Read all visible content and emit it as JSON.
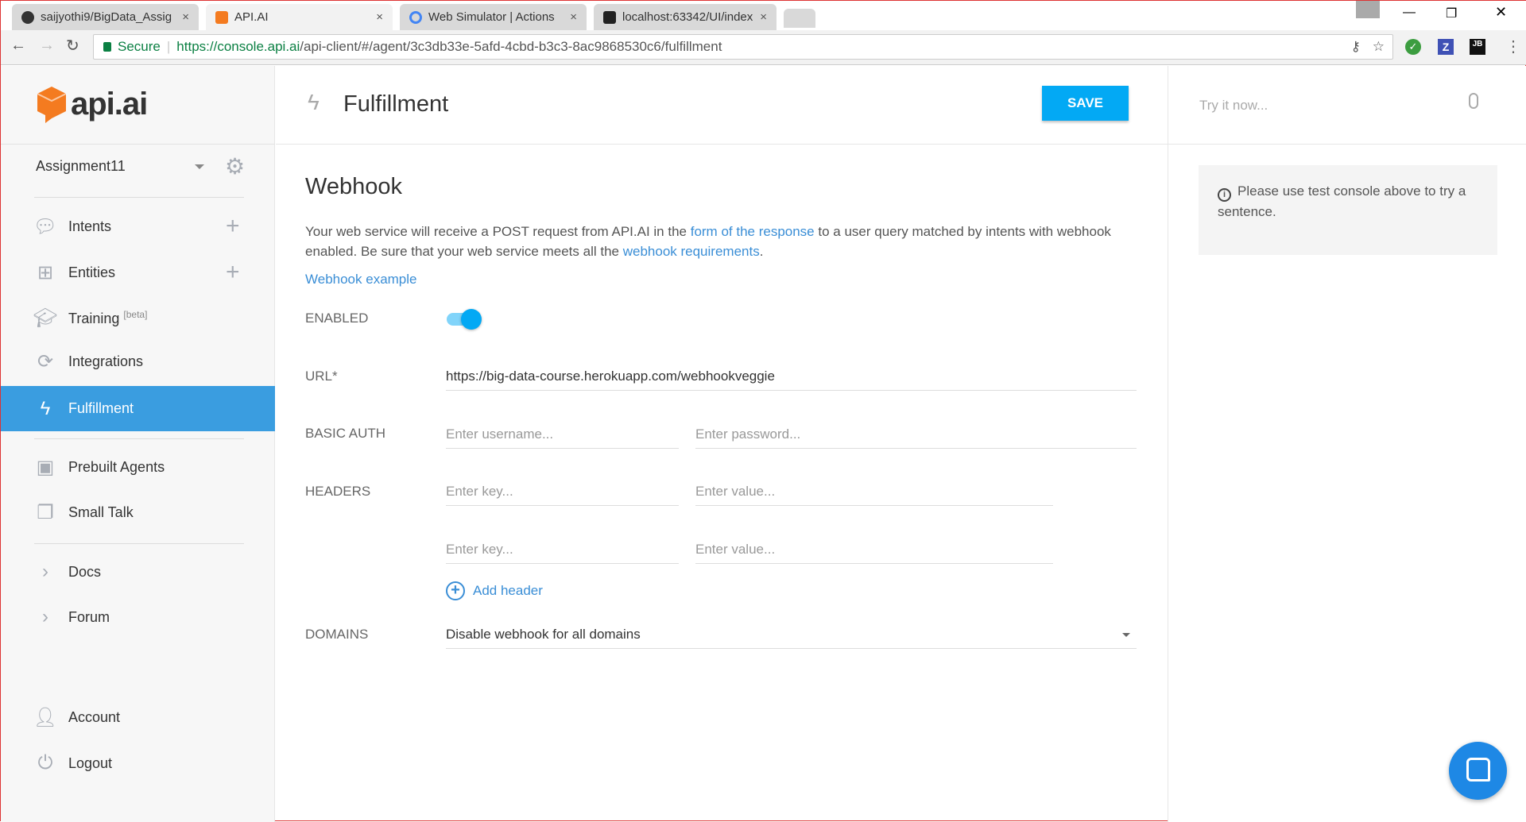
{
  "browser": {
    "tabs": [
      {
        "label": "saijyothi9/BigData_Assig",
        "icon": "github-icon"
      },
      {
        "label": "API.AI",
        "icon": "apiai-icon"
      },
      {
        "label": "Web Simulator | Actions",
        "icon": "google-actions-icon"
      },
      {
        "label": "localhost:63342/UI/index",
        "icon": "webstorm-icon"
      }
    ],
    "close": "×",
    "secure_label": "Secure",
    "url_host": "https://console.api.ai",
    "url_path": "/api-client/#/agent/3c3db33e-5afd-4cbd-b3c3-8ac9868530c6/fulfillment",
    "ext_z": "Z",
    "ext_jb": "JB"
  },
  "sidebar": {
    "logo": "api.ai",
    "agent": "Assignment11",
    "items": [
      {
        "label": "Intents"
      },
      {
        "label": "Entities"
      },
      {
        "label": "Training",
        "badge": "[beta]"
      },
      {
        "label": "Integrations"
      },
      {
        "label": "Fulfillment"
      },
      {
        "label": "Prebuilt Agents"
      },
      {
        "label": "Small Talk"
      },
      {
        "label": "Docs"
      },
      {
        "label": "Forum"
      },
      {
        "label": "Account"
      },
      {
        "label": "Logout"
      }
    ]
  },
  "header": {
    "title": "Fulfillment",
    "save": "SAVE"
  },
  "webhook": {
    "title": "Webhook",
    "desc1": "Your web service will receive a POST request from API.AI in the ",
    "link1": "form of the response",
    "desc2": " to a user query matched by intents with webhook enabled. Be sure that your web service meets all the ",
    "link2": "webhook requirements",
    "desc3": ".",
    "example": "Webhook example",
    "enabled_label": "ENABLED",
    "enabled": true,
    "url_label": "URL*",
    "url": "https://big-data-course.herokuapp.com/webhookveggie",
    "auth_label": "BASIC AUTH",
    "username_ph": "Enter username...",
    "password_ph": "Enter password...",
    "headers_label": "HEADERS",
    "key_ph": "Enter key...",
    "value_ph": "Enter value...",
    "add_header": "Add header",
    "domains_label": "DOMAINS",
    "domains_value": "Disable webhook for all domains"
  },
  "console": {
    "placeholder": "Try it now...",
    "info": "Please use test console above to try a sentence."
  },
  "colors": {
    "accent": "#3a9de0",
    "save": "#03a9f4",
    "logo": "#f47b20"
  }
}
